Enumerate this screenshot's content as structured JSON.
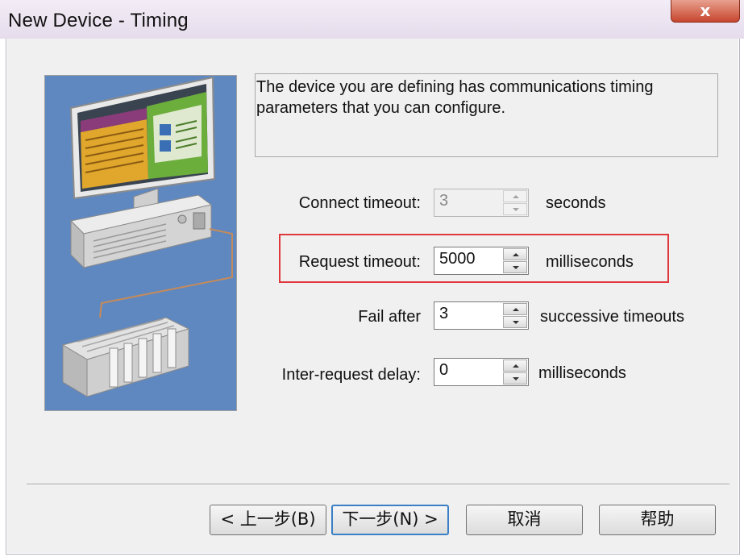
{
  "window": {
    "title": "New Device - Timing",
    "close_glyph": "x"
  },
  "info": {
    "text": "The device you are defining has communications timing parameters that you can configure."
  },
  "fields": {
    "connect_timeout": {
      "label": "Connect timeout:",
      "value": "3",
      "unit": "seconds",
      "enabled": false
    },
    "request_timeout": {
      "label": "Request timeout:",
      "value": "5000",
      "unit": "milliseconds",
      "enabled": true
    },
    "fail_after": {
      "label": "Fail after",
      "value": "3",
      "unit": "successive timeouts",
      "enabled": true
    },
    "inter_request_delay": {
      "label": "Inter-request delay:",
      "value": "0",
      "unit": "milliseconds",
      "enabled": true
    }
  },
  "buttons": {
    "back": "< 上一步(B)",
    "next": "下一步(N) >",
    "cancel": "取消",
    "help": "帮助"
  },
  "colors": {
    "highlight_border": "#e0373d",
    "illustration_bg": "#5f88c0"
  },
  "icons": {
    "close": "close-icon",
    "spin_up": "spin-up-arrow-icon",
    "spin_down": "spin-down-arrow-icon"
  }
}
